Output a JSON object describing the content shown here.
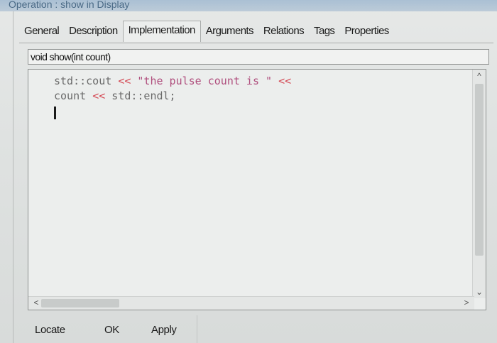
{
  "window": {
    "title": "Operation : show in Display"
  },
  "tabs": [
    {
      "label": "General",
      "active": false
    },
    {
      "label": "Description",
      "active": false
    },
    {
      "label": "Implementation",
      "active": true
    },
    {
      "label": "Arguments",
      "active": false
    },
    {
      "label": "Relations",
      "active": false
    },
    {
      "label": "Tags",
      "active": false
    },
    {
      "label": "Properties",
      "active": false
    }
  ],
  "signature": {
    "value": "void show(int count)"
  },
  "editor": {
    "line1": {
      "t1": "std::cout ",
      "op1": "<<",
      "str": " \"the pulse count is \" ",
      "op2": "<<"
    },
    "line2": {
      "t1": "count ",
      "op1": "<<",
      "t2": " std::endl;"
    }
  },
  "icons": {
    "up": "scroll-up-arrow",
    "down": "scroll-down-arrow",
    "left": "scroll-left-arrow",
    "right": "scroll-right-arrow"
  },
  "buttons": {
    "locate": "Locate",
    "ok": "OK",
    "apply": "Apply"
  },
  "colors": {
    "operator": "#d44a55",
    "string": "#b04f7e",
    "code_text": "#6b6b6b"
  }
}
